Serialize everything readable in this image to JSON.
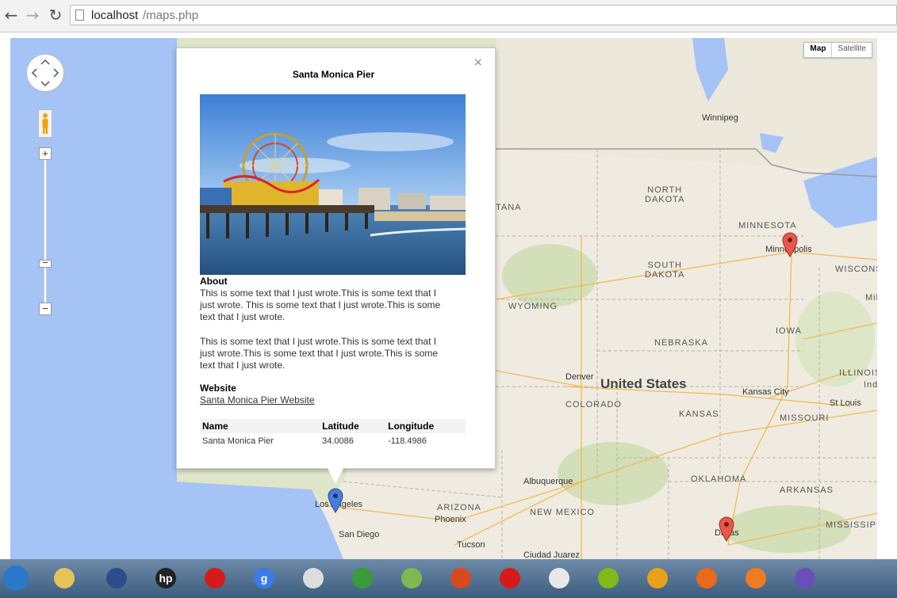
{
  "browser": {
    "back_icon": "back-arrow-icon",
    "forward_icon": "forward-arrow-icon",
    "reload_icon": "reload-icon",
    "url_host": "localhost",
    "url_path": "/maps.php"
  },
  "map": {
    "map_type_buttons": [
      "Map",
      "Satellite"
    ],
    "selected_map_type": "Map",
    "zoom_in_label": "+",
    "zoom_out_label": "−",
    "zoom_mid_label": "−",
    "country_label": "United States",
    "region_labels": {
      "north_dakota": "NORTH\nDAKOTA",
      "south_dakota": "SOUTH\nDAKOTA",
      "minnesota": "MINNESOTA",
      "wisconsin": "WISCONS",
      "mi": "Mil",
      "wyoming": "WYOMING",
      "iowa": "IOWA",
      "nebraska": "NEBRASKA",
      "illinois": "ILLINOIS",
      "ind": "Ind",
      "colorado": "COLORADO",
      "kansas": "KANSAS",
      "missouri": "MISSOURI",
      "oklahoma": "OKLAHOMA",
      "arkansas": "ARKANSAS",
      "new_mexico": "NEW MEXICO",
      "arizona": "ARIZONA",
      "mississippi": "MISSISSIPI",
      "montana": "TANA"
    },
    "cities": {
      "winnipeg": "Winnipeg",
      "minneapolis": "Minneapolis",
      "denver": "Denver",
      "kansas_city": "Kansas City",
      "st_louis": "St Louis",
      "albuquerque": "Albuquerque",
      "los_angeles": "Los Angeles",
      "phoenix": "Phoenix",
      "san_diego": "San Diego",
      "tucson": "Tucson",
      "ciudad_juarez": "Ciudad Juarez",
      "dallas": "Dallas"
    },
    "markers": [
      {
        "name": "los-angeles-marker",
        "color": "#4a7be0"
      },
      {
        "name": "minneapolis-marker",
        "color": "#e8574b"
      },
      {
        "name": "dallas-marker",
        "color": "#e8574b"
      }
    ]
  },
  "info_window": {
    "title": "Santa Monica Pier",
    "close_label": "×",
    "about_heading": "About",
    "about_para1": "This is some text that I just wrote.This is some text that I just wrote. This is some text that I just wrote.This is some text that I just wrote.",
    "about_para2": "This is some text that I just wrote.This is some text that I just wrote.This is some text that I just wrote.This is some text that I just wrote.",
    "website_heading": "Website",
    "website_link": "Santa Monica Pier Website",
    "table": {
      "headers": [
        "Name",
        "Latitude",
        "Longitude"
      ],
      "row": [
        "Santa Monica Pier",
        "34.0086",
        "-118.4986"
      ]
    }
  },
  "taskbar": {
    "items": [
      {
        "name": "start-button-icon",
        "color": "#2a78c8"
      },
      {
        "name": "file-explorer-icon",
        "color": "#e6c35a"
      },
      {
        "name": "check-app-icon",
        "color": "#2c4d88"
      },
      {
        "name": "hp-icon",
        "color": "#222222",
        "text": "hp"
      },
      {
        "name": "opera-icon",
        "color": "#d61a1a"
      },
      {
        "name": "google-search-icon",
        "color": "#3b7be8",
        "text": "g"
      },
      {
        "name": "microphone-icon",
        "color": "#dddddd"
      },
      {
        "name": "chrome-icon",
        "color": "#3a9b3a"
      },
      {
        "name": "notepad-plus-icon",
        "color": "#7fb94f"
      },
      {
        "name": "presentation-app-icon",
        "color": "#d84a1b"
      },
      {
        "name": "opera-icon-2",
        "color": "#d61a1a"
      },
      {
        "name": "tiles-app-icon",
        "color": "#e8e8e8"
      },
      {
        "name": "spotify-icon",
        "color": "#80b919"
      },
      {
        "name": "player-icon",
        "color": "#e8a11a"
      },
      {
        "name": "firefox-icon",
        "color": "#e86a1a"
      },
      {
        "name": "xampp-icon",
        "color": "#f07b22"
      },
      {
        "name": "cat-app-icon",
        "color": "#6b4fb8"
      }
    ]
  }
}
